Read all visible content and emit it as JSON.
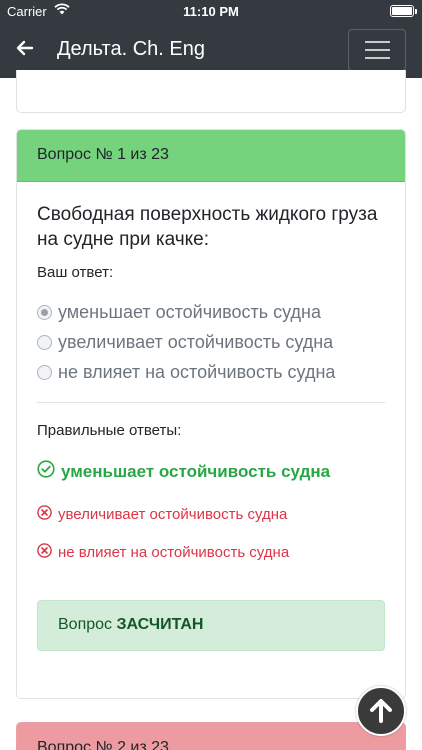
{
  "status_bar": {
    "carrier": "Carrier",
    "time": "11:10 PM"
  },
  "navbar": {
    "title": "Дельта. Ch. Eng"
  },
  "question_card": {
    "header": "Вопрос № 1 из 23",
    "question": "Свободная поверхность жидкого груза на судне при качке:",
    "your_answer_label": "Ваш ответ:",
    "options": [
      {
        "label": "уменьшает остойчивость судна",
        "selected": true
      },
      {
        "label": "увеличивает остойчивость судна",
        "selected": false
      },
      {
        "label": "не влияет на остойчивость судна",
        "selected": false
      }
    ],
    "correct_label": "Правильные ответы:",
    "results": [
      {
        "label": "уменьшает остойчивость судна",
        "status": "correct"
      },
      {
        "label": "увеличивает остойчивость судна",
        "status": "wrong"
      },
      {
        "label": "не влияет на остойчивость судна",
        "status": "wrong"
      }
    ],
    "verdict_prefix": "Вопрос",
    "verdict": "ЗАСЧИТАН",
    "header_color": "#74d37c"
  },
  "next_card": {
    "header": "Вопрос № 2 из 23",
    "header_color": "#ee9aa1"
  },
  "icons": {
    "back": "arrow-left-icon",
    "menu": "hamburger-icon",
    "scroll_top": "arrow-up-icon",
    "correct": "check-circle-icon",
    "wrong": "x-circle-icon"
  }
}
